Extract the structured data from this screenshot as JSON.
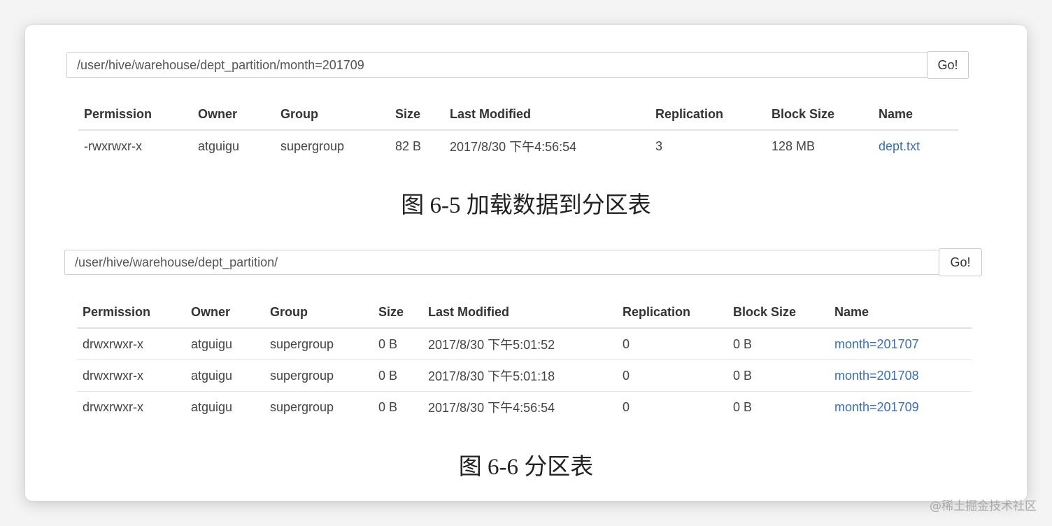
{
  "figures": [
    {
      "path_value": "/user/hive/warehouse/dept_partition/month=201709",
      "go_label": "Go!",
      "columns": [
        "Permission",
        "Owner",
        "Group",
        "Size",
        "Last Modified",
        "Replication",
        "Block Size",
        "Name"
      ],
      "rows": [
        [
          "-rwxrwxr-x",
          "atguigu",
          "supergroup",
          "82 B",
          "2017/8/30 下午4:56:54",
          "3",
          "128 MB",
          "dept.txt"
        ]
      ],
      "caption": "图 6-5  加载数据到分区表"
    },
    {
      "path_value": "/user/hive/warehouse/dept_partition/",
      "go_label": "Go!",
      "columns": [
        "Permission",
        "Owner",
        "Group",
        "Size",
        "Last Modified",
        "Replication",
        "Block Size",
        "Name"
      ],
      "rows": [
        [
          "drwxrwxr-x",
          "atguigu",
          "supergroup",
          "0 B",
          "2017/8/30 下午5:01:52",
          "0",
          "0 B",
          "month=201707"
        ],
        [
          "drwxrwxr-x",
          "atguigu",
          "supergroup",
          "0 B",
          "2017/8/30 下午5:01:18",
          "0",
          "0 B",
          "month=201708"
        ],
        [
          "drwxrwxr-x",
          "atguigu",
          "supergroup",
          "0 B",
          "2017/8/30 下午4:56:54",
          "0",
          "0 B",
          "month=201709"
        ]
      ],
      "caption": "图 6-6  分区表"
    }
  ],
  "watermark": "@稀土掘金技术社区"
}
